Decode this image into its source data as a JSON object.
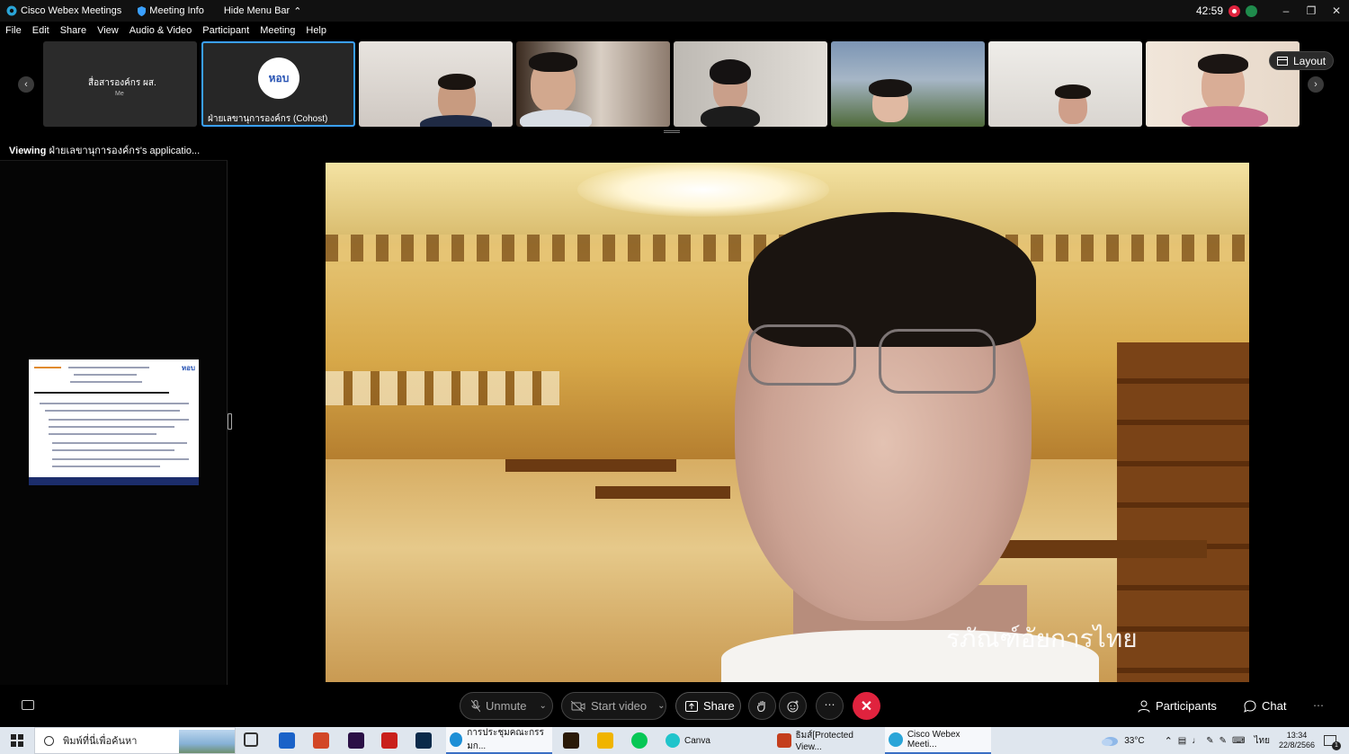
{
  "titlebar": {
    "app_title": "Cisco Webex Meetings",
    "meeting_info": "Meeting Info",
    "hide_menu": "Hide Menu Bar",
    "timer": "42:59"
  },
  "menu": [
    "File",
    "Edit",
    "Share",
    "View",
    "Audio & Video",
    "Participant",
    "Meeting",
    "Help"
  ],
  "filmstrip": {
    "self_tile": {
      "name": "สื่อสารองค์กร ผส.",
      "sub": "Me"
    },
    "cohost_tile": {
      "name": "ฝ่ายเลขานุการองค์กร (Cohost)",
      "logo_text": "หอบ"
    },
    "layout_label": "Layout"
  },
  "viewing": {
    "prefix": "Viewing",
    "text": "ฝ่ายเลขานุการองค์กร's applicatio..."
  },
  "slide": {
    "logo_text": "หอบ"
  },
  "video": {
    "watermark": "รภัณฑ์อัยการไทย"
  },
  "controls": {
    "unmute": "Unmute",
    "start_video": "Start video",
    "share": "Share",
    "participants": "Participants",
    "chat": "Chat",
    "end_color": "#e0233e"
  },
  "taskbar": {
    "search_placeholder": "พิมพ์ที่นี่เพื่อค้นหา",
    "apps": [
      {
        "label": "การประชุมคณะกรรมก..."
      },
      {
        "label": "Canva"
      },
      {
        "label": "ธิมส์[Protected View..."
      },
      {
        "label": "Cisco Webex Meeti..."
      }
    ],
    "temperature": "33°C",
    "language": "ไทย",
    "time": "13:34",
    "date": "22/8/2566",
    "notifications": "1"
  }
}
